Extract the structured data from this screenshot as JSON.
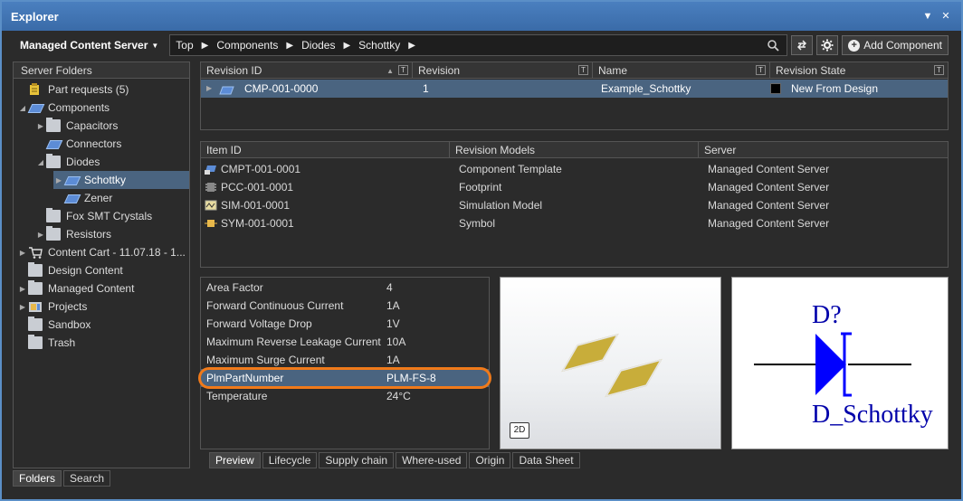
{
  "window": {
    "title": "Explorer"
  },
  "toolbar": {
    "server": "Managed Content Server",
    "breadcrumbs": [
      "Top",
      "Components",
      "Diodes",
      "Schottky"
    ],
    "add_component": "Add Component"
  },
  "server_folders": {
    "header": "Server Folders",
    "items": [
      {
        "label": "Part requests (5)",
        "icon": "part-request-icon"
      },
      {
        "label": "Components",
        "icon": "component-icon"
      },
      {
        "label": "Capacitors",
        "icon": "folder-icon"
      },
      {
        "label": "Connectors",
        "icon": "component-icon"
      },
      {
        "label": "Diodes",
        "icon": "folder-icon"
      },
      {
        "label": "Schottky",
        "icon": "component-icon"
      },
      {
        "label": "Zener",
        "icon": "component-icon"
      },
      {
        "label": "Fox SMT Crystals",
        "icon": "folder-icon"
      },
      {
        "label": "Resistors",
        "icon": "folder-icon"
      },
      {
        "label": "Content Cart - 11.07.18 - 1...",
        "icon": "cart-icon"
      },
      {
        "label": "Design Content",
        "icon": "folder-icon"
      },
      {
        "label": "Managed Content",
        "icon": "folder-icon"
      },
      {
        "label": "Projects",
        "icon": "project-icon"
      },
      {
        "label": "Sandbox",
        "icon": "folder-icon"
      },
      {
        "label": "Trash",
        "icon": "folder-icon"
      }
    ]
  },
  "left_tabs": [
    "Folders",
    "Search"
  ],
  "revisions_grid": {
    "columns": [
      "Revision ID",
      "Revision",
      "Name",
      "Revision State"
    ],
    "rows": [
      {
        "id": "CMP-001-0000",
        "revision": "1",
        "name": "Example_Schottky",
        "state": "New From Design",
        "state_color": "#000000"
      }
    ]
  },
  "items_grid": {
    "columns": [
      "Item ID",
      "Revision Models",
      "Server"
    ],
    "rows": [
      {
        "id": "CMPT-001-0001",
        "model": "Component Template",
        "server": "Managed Content Server",
        "icon": "component-template-icon"
      },
      {
        "id": "PCC-001-0001",
        "model": "Footprint",
        "server": "Managed Content Server",
        "icon": "footprint-icon"
      },
      {
        "id": "SIM-001-0001",
        "model": "Simulation Model",
        "server": "Managed Content Server",
        "icon": "simulation-model-icon"
      },
      {
        "id": "SYM-001-0001",
        "model": "Symbol",
        "server": "Managed Content Server",
        "icon": "symbol-icon"
      }
    ]
  },
  "parameters": [
    {
      "name": "Area Factor",
      "value": "4"
    },
    {
      "name": "Forward Continuous Current",
      "value": "1A"
    },
    {
      "name": "Forward Voltage Drop",
      "value": "1V"
    },
    {
      "name": "Maximum Reverse Leakage Current",
      "value": "10A"
    },
    {
      "name": "Maximum Surge Current",
      "value": "1A"
    },
    {
      "name": "PlmPartNumber",
      "value": "PLM-FS-8"
    },
    {
      "name": "Temperature",
      "value": "24°C"
    }
  ],
  "preview": {
    "view_toggle": "2D"
  },
  "symbol": {
    "designator": "D?",
    "comment": "D_Schottky"
  },
  "bottom_tabs": [
    "Preview",
    "Lifecycle",
    "Supply chain",
    "Where-used",
    "Origin",
    "Data Sheet"
  ],
  "colors": {
    "accent": "#4a6480",
    "highlight": "#f07a1a",
    "symbol_blue": "#0000ff"
  }
}
